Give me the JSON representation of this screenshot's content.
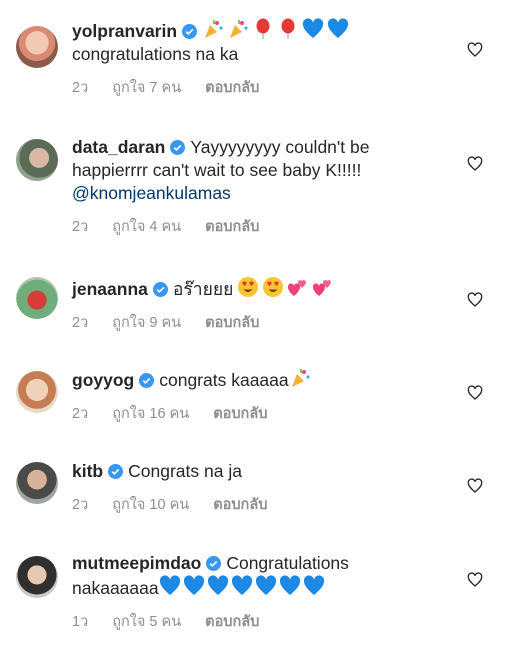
{
  "comments": [
    {
      "username": "yolpranvarin",
      "lines": [
        "congratulations na ka"
      ],
      "emojis": [
        "party-popper",
        "party-popper",
        "red-balloon",
        "red-balloon",
        "blue-heart",
        "blue-heart"
      ],
      "time": "2ว",
      "likes": "ถูกใจ 7 คน",
      "reply": "ตอบกลับ"
    },
    {
      "username": "data_daran",
      "text_first": "Yayyyyyyyy couldn't be",
      "lines": [
        "happierrrr can't wait to see baby K!!!!!"
      ],
      "mention": "@knomjeankulamas",
      "time": "2ว",
      "likes": "ถูกใจ 4 คน",
      "reply": "ตอบกลับ"
    },
    {
      "username": "jenaanna",
      "text_first": "อร๊ายยย",
      "emojis": [
        "heart-eyes-face",
        "heart-eyes-face",
        "two-hearts",
        "two-hearts"
      ],
      "time": "2ว",
      "likes": "ถูกใจ 9 คน",
      "reply": "ตอบกลับ"
    },
    {
      "username": "goyyog",
      "text_first": "congrats kaaaaa",
      "emojis": [
        "party-popper"
      ],
      "time": "2ว",
      "likes": "ถูกใจ 16 คน",
      "reply": "ตอบกลับ"
    },
    {
      "username": "kitb",
      "text_first": "Congrats na ja",
      "time": "2ว",
      "likes": "ถูกใจ 10 คน",
      "reply": "ตอบกลับ"
    },
    {
      "username": "mutmeepimdao",
      "text_first": "Congratulations",
      "lines": [
        "nakaaaaaa"
      ],
      "emojis": [
        "blue-heart",
        "blue-heart",
        "blue-heart",
        "blue-heart",
        "blue-heart",
        "blue-heart",
        "blue-heart"
      ],
      "time": "1ว",
      "likes": "ถูกใจ 5 คน",
      "reply": "ตอบกลับ"
    }
  ],
  "colors": {
    "text": "#262626",
    "secondary": "#8e8e8e",
    "verified": "#3897f0",
    "mention": "#00376b"
  }
}
